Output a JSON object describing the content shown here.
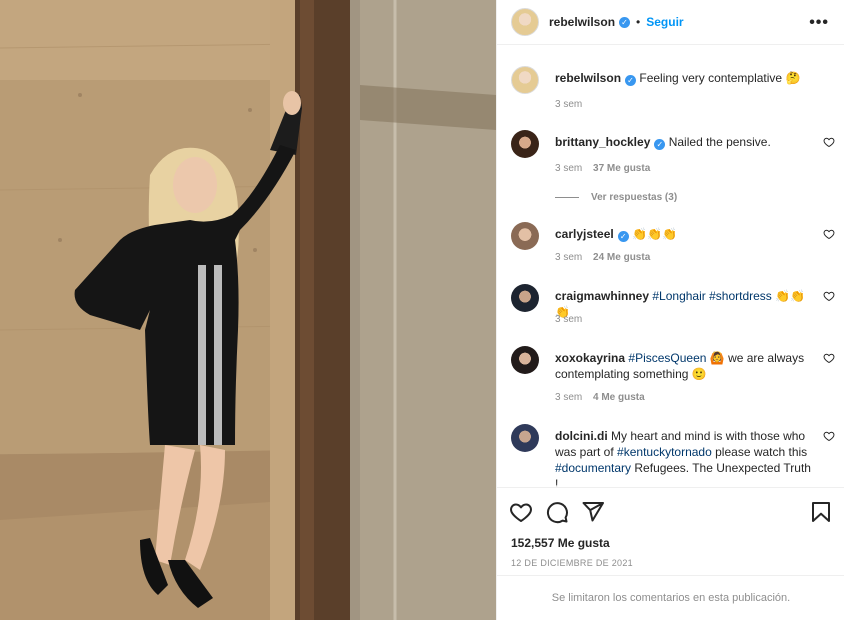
{
  "header": {
    "username": "rebelwilson",
    "separator": "•",
    "follow_label": "Seguir",
    "more_label": "•••"
  },
  "caption": {
    "username": "rebelwilson",
    "text": "Feeling very contemplative 🤔",
    "time": "3 sem"
  },
  "comments": [
    {
      "username": "brittany_hockley",
      "verified": true,
      "text": "Nailed the pensive.",
      "time": "3 sem",
      "likes": "37 Me gusta",
      "replies": "Ver respuestas (3)"
    },
    {
      "username": "carlyjsteel",
      "verified": true,
      "text": "👏👏👏",
      "time": "3 sem",
      "likes": "24 Me gusta"
    },
    {
      "username": "craigmawhinney",
      "verified": false,
      "tags": [
        "#Longhair",
        "#shortdress"
      ],
      "text_after": "👏👏👏",
      "time": "3 sem"
    },
    {
      "username": "xoxokayrina",
      "verified": false,
      "tag": "#PiscesQueen",
      "text_a": "🙆",
      "text_b": "we are always contemplating something 🙂",
      "time": "3 sem",
      "likes": "4 Me gusta"
    },
    {
      "username": "dolcini.di",
      "verified": false,
      "text_a": "My heart and mind is with those who was part of",
      "tag1": "#kentuckytornado",
      "text_b": "please watch this",
      "tag2": "#documentary",
      "text_c": "Refugees. The Unexpected Truth !"
    }
  ],
  "footer": {
    "likes": "152,557 Me gusta",
    "date": "12 DE DICIEMBRE DE 2021",
    "limited": "Se limitaron los comentarios en esta publicación."
  },
  "icons": {
    "like": "heart-icon",
    "comment": "comment-icon",
    "share": "share-icon",
    "save": "bookmark-icon",
    "verified": "verified-badge-icon",
    "more": "more-options-icon"
  },
  "colors": {
    "accent": "#0095f6",
    "verified": "#3897f0",
    "hashtag": "#00376b",
    "muted": "#8e8e8e",
    "border": "#efefef"
  }
}
